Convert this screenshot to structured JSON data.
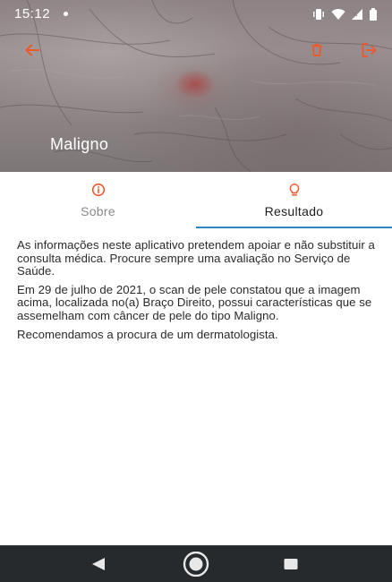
{
  "status_bar": {
    "time": "15:12",
    "icons": [
      "notification-dot-icon",
      "vibrate-icon",
      "wifi-icon",
      "signal-icon",
      "battery-icon"
    ]
  },
  "app_bar": {
    "icons": [
      "arrow-back-icon",
      "trash-icon",
      "exit-icon"
    ]
  },
  "hero": {
    "title": "Maligno"
  },
  "tabs": [
    {
      "label": "Sobre",
      "icon": "info-icon",
      "selected": false
    },
    {
      "label": "Resultado",
      "icon": "lightbulb-icon",
      "selected": true
    }
  ],
  "content": {
    "paragraphs": [
      "As informações neste aplicativo pretendem apoiar e não substituir a consulta médica. Procure sempre uma avaliação no Serviço de Saúde.",
      "Em 29 de julho de 2021, o scan de pele constatou que a imagem acima, localizada no(a) Braço Direito, possui características que se assemelham com câncer de pele do tipo Maligno.",
      "Recomendamos a procura de um dermatologista."
    ]
  },
  "colors": {
    "accent": "#f0582a",
    "tab_indicator": "#2f86c4",
    "nav_bar": "#262a2c"
  },
  "nav_bar": {
    "icons": [
      "back-triangle-icon",
      "home-circle-icon",
      "recent-apps-icon"
    ]
  }
}
